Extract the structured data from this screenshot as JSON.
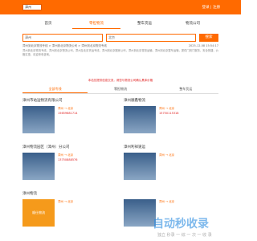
{
  "header": {
    "city": "漳州",
    "login": "登录 | 注册"
  },
  "nav": [
    "首页",
    "零担物流",
    "整车货运",
    "物流公司"
  ],
  "search": {
    "from": "漳州",
    "to": "北京",
    "button": "搜索"
  },
  "breadcrumb": "漳州到北京物流专线 > 漳州到北京物流公司 > 漳州到北京物流专线",
  "time": "2025-12-08 15:54:17",
  "intro": "漳州到北京物流专线，漳州到北京物流公司，漳州至北京货运专线，漳州到北京搬家公司，漳州到北京零担运输，漳州到北京整车运输，提供门到门服务，安全快捷，价格实惠，欢迎来电咨询。",
  "notice": "本站仅提供信息交流，请您与物流公司确认具体价格",
  "tabs": [
    "全部专线",
    "零担物流",
    "整车货运"
  ],
  "cards": [
    {
      "title": "漳州市站运物流有限公司",
      "route": "漳州 → 北京",
      "tel": "15659681714",
      "thumb": ""
    },
    {
      "title": "漳州顺鑫物流",
      "route": "漳州 → 北京",
      "tel": "15750115318",
      "thumb": ""
    },
    {
      "title": "漳州物流园区（漳州）分公司",
      "route": "漳州 → 北京",
      "tel": "13750888576",
      "thumb": ""
    },
    {
      "title": "漳州利祥速运",
      "route": "漳州 → 北京",
      "tel": "",
      "thumb": ""
    },
    {
      "title": "漳州物流",
      "route": "漳州 → 北京",
      "tel": "",
      "thumb": "顺仕物流"
    },
    {
      "title": "",
      "route": "漳州 → 北京",
      "tel": "",
      "thumb": ""
    }
  ],
  "watermark": {
    "main": "自动秒收录",
    "sub": "独立 秒录 一 综 一 次 一 收 录"
  }
}
